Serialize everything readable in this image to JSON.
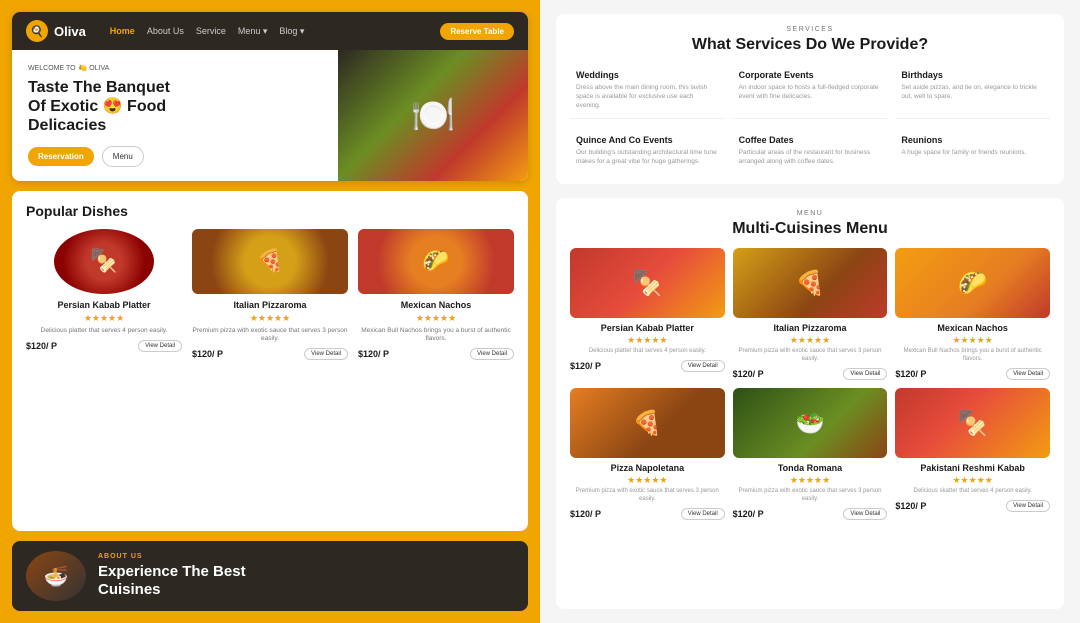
{
  "left": {
    "nav": {
      "logo_icon": "🍳",
      "logo_text": "Oliva",
      "links": [
        "Home",
        "About Us",
        "Service",
        "Menu ▾",
        "Blog ▾"
      ],
      "reserve_label": "Reserve Table"
    },
    "hero": {
      "welcome_label": "WELCOME TO",
      "welcome_brand": "🍋 OLIVA",
      "title_line1": "Taste The Banquet",
      "title_line2": "Of Exotic 😍 Food",
      "title_line3": "Delicacies",
      "btn_reservation": "Reservation",
      "btn_menu": "Menu",
      "food_emoji": "🍽️"
    },
    "popular": {
      "section_title": "Popular Dishes",
      "dishes": [
        {
          "name": "Persian Kabab Platter",
          "stars": "★★★★★",
          "desc": "Delicious platter that serves 4 person easily.",
          "price": "$120/ P",
          "btn": "View Detail",
          "emoji": "🍢"
        },
        {
          "name": "Italian Pizzaroma",
          "stars": "★★★★★",
          "desc": "Premium pizza with exotic sauce that serves 3 person easily.",
          "price": "$120/ P",
          "btn": "View Detail",
          "emoji": "🍕"
        },
        {
          "name": "Mexican Nachos",
          "stars": "★★★★★",
          "desc": "Mexican Bull Nachos brings you a burst of authentic flavors.",
          "price": "$120/ P",
          "btn": "View Detail",
          "emoji": "🌮"
        }
      ]
    },
    "about": {
      "label": "ABOUT US",
      "title_line1": "Experience The Best",
      "title_line2": "Cuisines",
      "emoji": "🍜"
    }
  },
  "right": {
    "services": {
      "section_label": "SERVICES",
      "section_title": "What Services Do We Provide?",
      "items": [
        {
          "name": "Weddings",
          "desc": "Dress above the main dining room, this lavish space is available for exclusive use each evening."
        },
        {
          "name": "Corporate Events",
          "desc": "An indoor space to hosts a full-fledged corporate event with fine delicacies."
        },
        {
          "name": "Birthdays",
          "desc": "Set aside pizzas, and tie on, elegance to trickle out, well to spare."
        },
        {
          "name": "Quince And Co Events",
          "desc": "Our building's outstanding architectural time tune makes for a great vibe for huge gatherings."
        },
        {
          "name": "Coffee Dates",
          "desc": "Particular areas of the restaurant for business arranged along with coffee dates."
        },
        {
          "name": "Reunions",
          "desc": "A huge space for family or friends reunions."
        }
      ]
    },
    "menu": {
      "section_label": "MENU",
      "section_title": "Multi-Cuisines Menu",
      "items": [
        {
          "name": "Persian Kabab Platter",
          "stars": "★★★★★",
          "desc": "Delicious platter that serves 4 person easily.",
          "price": "$120/ P",
          "btn": "View Detail",
          "emoji": "🍢",
          "img_class": "menu-img-persian"
        },
        {
          "name": "Italian Pizzaroma",
          "stars": "★★★★★",
          "desc": "Premium pizza with exotic sauce that serves 3 person easily.",
          "price": "$120/ P",
          "btn": "View Detail",
          "emoji": "🍕",
          "img_class": "menu-img-pizza"
        },
        {
          "name": "Mexican Nachos",
          "stars": "★★★★★",
          "desc": "Mexican Bull Nachos brings you a burst of authentic flavors.",
          "price": "$120/ P",
          "btn": "View Detail",
          "emoji": "🌮",
          "img_class": "menu-img-nachos"
        },
        {
          "name": "Pizza Napoletana",
          "stars": "★★★★★",
          "desc": "Premium pizza with exotic sauce that serves 3 person easily.",
          "price": "$120/ P",
          "btn": "View Detail",
          "emoji": "🍕",
          "img_class": "menu-img-napoletana"
        },
        {
          "name": "Tonda Romana",
          "stars": "★★★★★",
          "desc": "Premium pizza with exotic sauce that serves 3 person easily.",
          "price": "$120/ P",
          "btn": "View Detail",
          "emoji": "🥗",
          "img_class": "menu-img-romana"
        },
        {
          "name": "Pakistani Reshmi Kabab",
          "stars": "★★★★★",
          "desc": "Delicious skatter that serves 4 person easily.",
          "price": "$120/ P",
          "btn": "View Detail",
          "emoji": "🍢",
          "img_class": "menu-img-reshmi"
        }
      ]
    }
  }
}
